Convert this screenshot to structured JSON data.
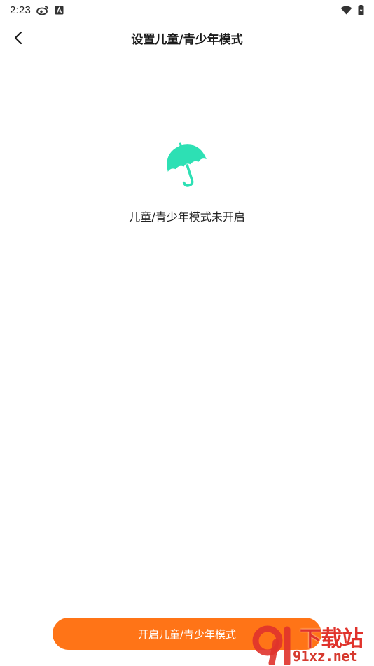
{
  "status_bar": {
    "time": "2:23",
    "left_icons": [
      "weibo-icon",
      "a-notification-icon"
    ],
    "right_icons": [
      "wifi-icon",
      "battery-charging-icon"
    ]
  },
  "header": {
    "title": "设置儿童/青少年模式",
    "back_icon": "chevron-left-icon"
  },
  "empty_state": {
    "icon": "umbrella-icon",
    "icon_color": "#2de0b4",
    "message": "儿童/青少年模式未开启"
  },
  "action": {
    "button_label": "开启儿童/青少年模式",
    "button_color": "#ff7417"
  },
  "watermark": {
    "title": "下载站",
    "domain": "91xz.net"
  }
}
